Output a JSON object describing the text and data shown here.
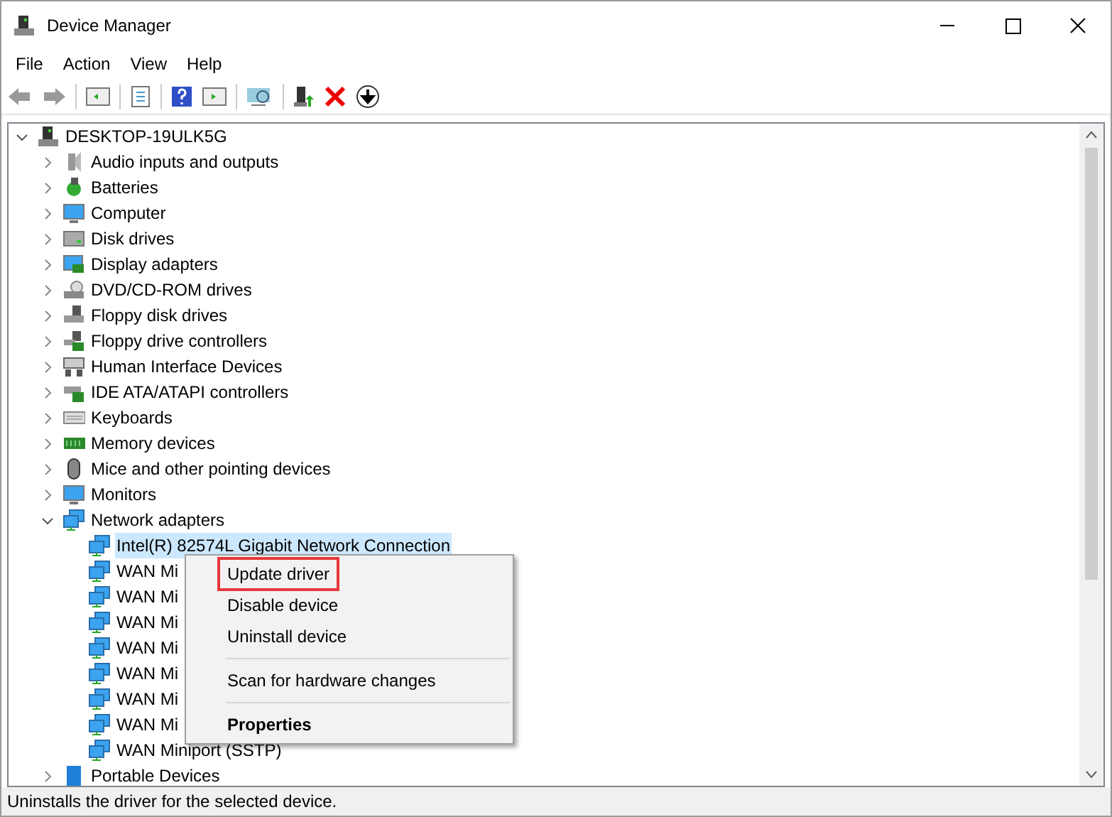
{
  "window": {
    "title": "Device Manager"
  },
  "menu_bar": [
    "File",
    "Action",
    "View",
    "Help"
  ],
  "tree": {
    "label": "DESKTOP-19ULK5G",
    "expanded": true,
    "children": [
      {
        "label": "Audio inputs and outputs",
        "expanded": false
      },
      {
        "label": "Batteries",
        "expanded": false
      },
      {
        "label": "Computer",
        "expanded": false
      },
      {
        "label": "Disk drives",
        "expanded": false
      },
      {
        "label": "Display adapters",
        "expanded": false
      },
      {
        "label": "DVD/CD-ROM drives",
        "expanded": false
      },
      {
        "label": "Floppy disk drives",
        "expanded": false
      },
      {
        "label": "Floppy drive controllers",
        "expanded": false
      },
      {
        "label": "Human Interface Devices",
        "expanded": false
      },
      {
        "label": "IDE ATA/ATAPI controllers",
        "expanded": false
      },
      {
        "label": "Keyboards",
        "expanded": false
      },
      {
        "label": "Memory devices",
        "expanded": false
      },
      {
        "label": "Mice and other pointing devices",
        "expanded": false
      },
      {
        "label": "Monitors",
        "expanded": false
      },
      {
        "label": "Network adapters",
        "expanded": true,
        "children": [
          {
            "label": "Intel(R) 82574L Gigabit Network Connection",
            "selected": true
          },
          {
            "label": "WAN Mi",
            "selected": false
          },
          {
            "label": "WAN Mi",
            "selected": false
          },
          {
            "label": "WAN Mi",
            "selected": false
          },
          {
            "label": "WAN Mi",
            "selected": false
          },
          {
            "label": "WAN Mi",
            "selected": false
          },
          {
            "label": "WAN Mi",
            "selected": false
          },
          {
            "label": "WAN Mi",
            "selected": false
          },
          {
            "label": "WAN Miniport (SSTP)",
            "selected": false
          }
        ]
      },
      {
        "label": "Portable Devices",
        "expanded": false
      }
    ]
  },
  "context_menu": [
    {
      "label": "Update driver",
      "highlighted": true,
      "default": false,
      "separator_before": false
    },
    {
      "label": "Disable device",
      "highlighted": false,
      "default": false,
      "separator_before": false
    },
    {
      "label": "Uninstall device",
      "highlighted": false,
      "default": false,
      "separator_before": false
    },
    {
      "label": "Scan for hardware changes",
      "highlighted": false,
      "default": false,
      "separator_before": true
    },
    {
      "label": "Properties",
      "highlighted": false,
      "default": true,
      "separator_before": true
    }
  ],
  "status_bar": "Uninstalls the driver for the selected device."
}
